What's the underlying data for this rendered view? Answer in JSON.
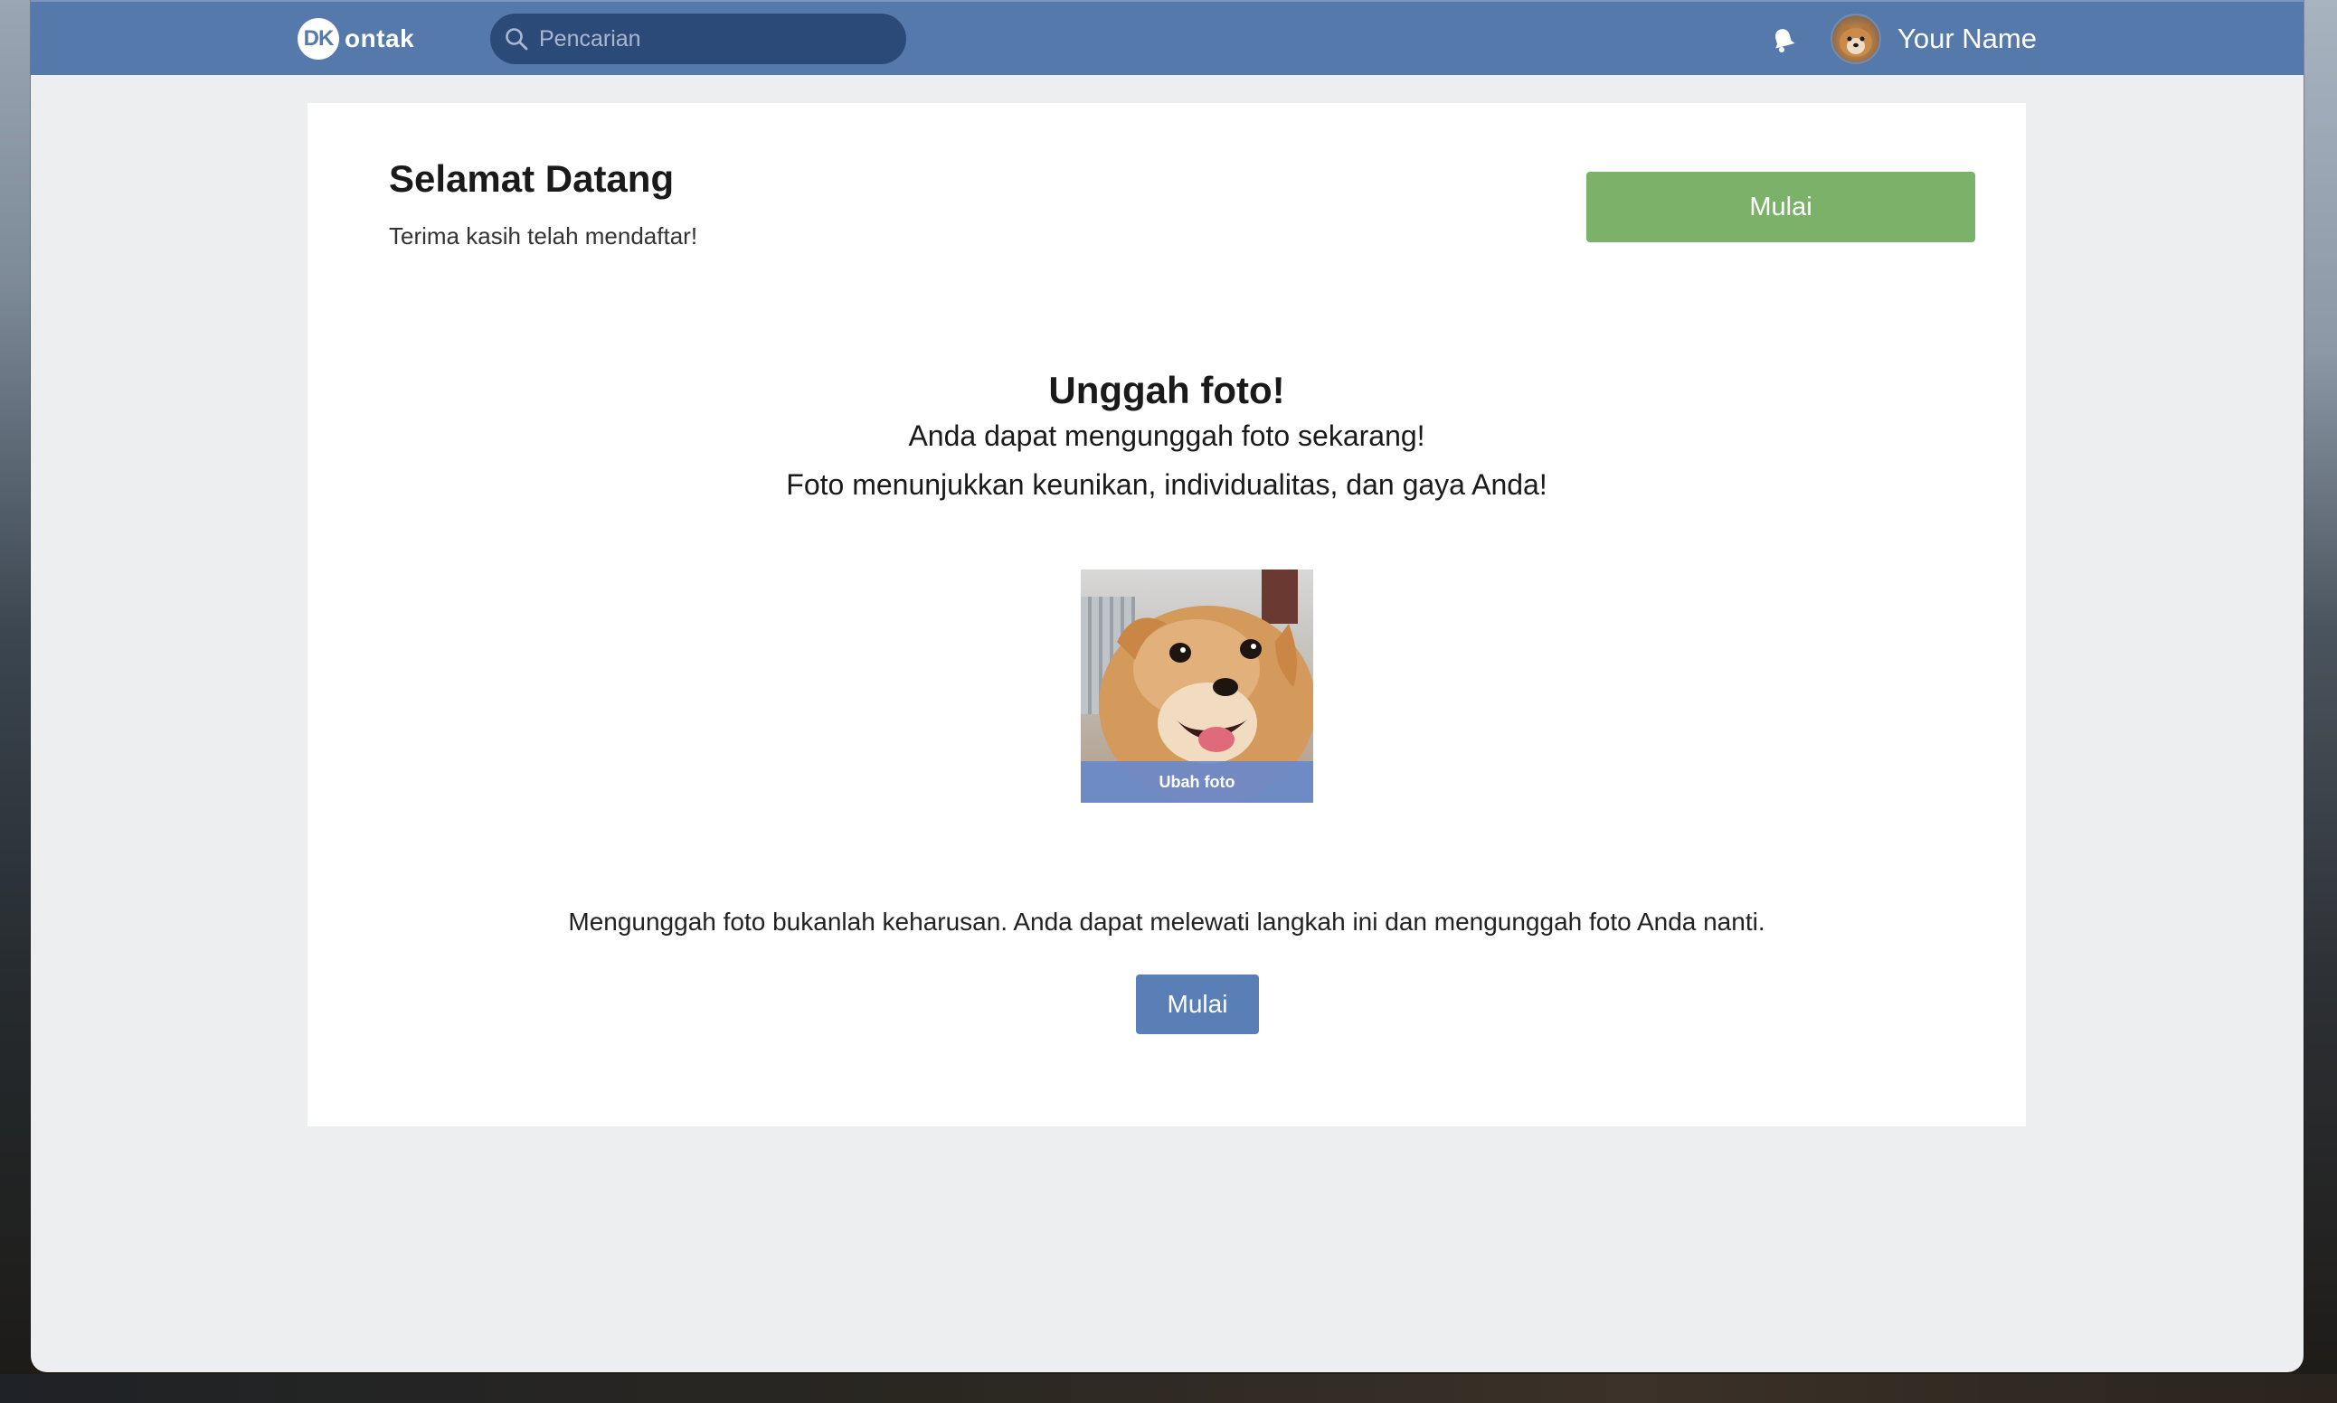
{
  "app": {
    "logo_badge": "DK",
    "logo_text": "ontak"
  },
  "header": {
    "search_placeholder": "Pencarian",
    "username": "Your Name",
    "icons": {
      "search": "search-icon",
      "notification": "bell-icon",
      "avatar": "avatar-dog"
    }
  },
  "welcome": {
    "title": "Selamat Datang",
    "subtitle": "Terima kasih telah mendaftar!",
    "start_button": "Mulai"
  },
  "upload": {
    "title": "Unggah foto!",
    "line1": "Anda dapat mengunggah foto sekarang!",
    "line2": "Foto menunjukkan keunikan, individualitas, dan gaya Anda!",
    "photo_caption": "Ubah foto",
    "skip_note": "Mengunggah foto bukanlah keharusan. Anda dapat melewati langkah ini dan mengunggah foto Anda nanti.",
    "start_button": "Mulai"
  },
  "colors": {
    "nav": "#5479aa",
    "search_bg": "#2b4a78",
    "green_button": "#7bb169",
    "blue_button": "#5a7fb6",
    "page_bg": "#edeef0"
  }
}
